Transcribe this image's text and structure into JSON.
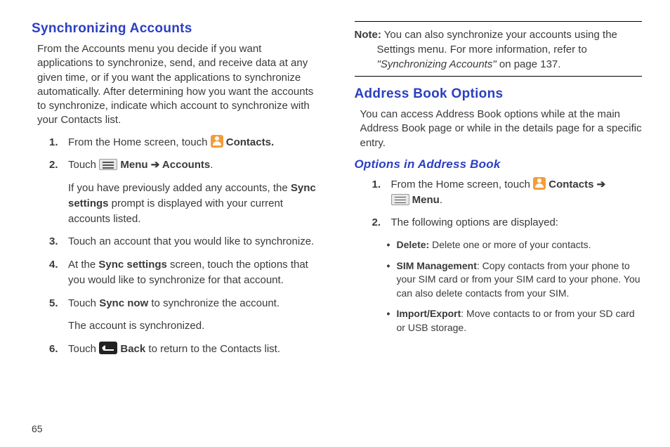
{
  "page_number": "65",
  "left": {
    "heading": "Synchronizing Accounts",
    "intro": "From the Accounts menu you decide if you want applications to synchronize, send, and receive data at any given time, or if you want the applications to synchronize automatically. After determining how you want the accounts to synchronize, indicate which account to synchronize with your Contacts list.",
    "steps": {
      "s1_a": "From the Home screen, touch ",
      "s1_b": "Contacts.",
      "s2_a": "Touch ",
      "s2_b": "Menu",
      "s2_c": "Accounts",
      "s2_extra_a": "If you have previously added any accounts, the ",
      "s2_extra_b": "Sync settings",
      "s2_extra_c": " prompt is displayed with your current accounts listed.",
      "s3": "Touch an account that you would like to synchronize.",
      "s4_a": "At the ",
      "s4_b": "Sync settings",
      "s4_c": " screen, touch the options that you would like to synchronize for that account.",
      "s5_a": "Touch ",
      "s5_b": "Sync now",
      "s5_c": " to synchronize the account.",
      "s5_extra": "The account is synchronized.",
      "s6_a": "Touch ",
      "s6_b": "Back",
      "s6_c": " to return to the Contacts list."
    }
  },
  "right": {
    "note_label": "Note:",
    "note_text_a": " You can also synchronize your accounts using the Settings menu. For more information, refer to ",
    "note_text_b": "\"Synchronizing Accounts\"",
    "note_text_c": " on page 137.",
    "heading": "Address Book Options",
    "intro": "You can access Address Book options while at the main Address Book page or while in the details page for a specific entry.",
    "sub_heading": "Options in Address Book",
    "steps": {
      "s1_a": "From the Home screen, touch ",
      "s1_b": "Contacts",
      "s1_c": "Menu",
      "s2": "The following options are displayed:"
    },
    "bullets": {
      "b1_a": "Delete:",
      "b1_b": " Delete one or more of your contacts.",
      "b2_a": "SIM Management",
      "b2_b": ": Copy contacts from your phone to your SIM card or from your SIM card to your phone. You can also delete contacts from your SIM.",
      "b3_a": "Import/Export",
      "b3_b": ": Move contacts to or from your SD card or USB storage."
    }
  },
  "arrow": "➔"
}
